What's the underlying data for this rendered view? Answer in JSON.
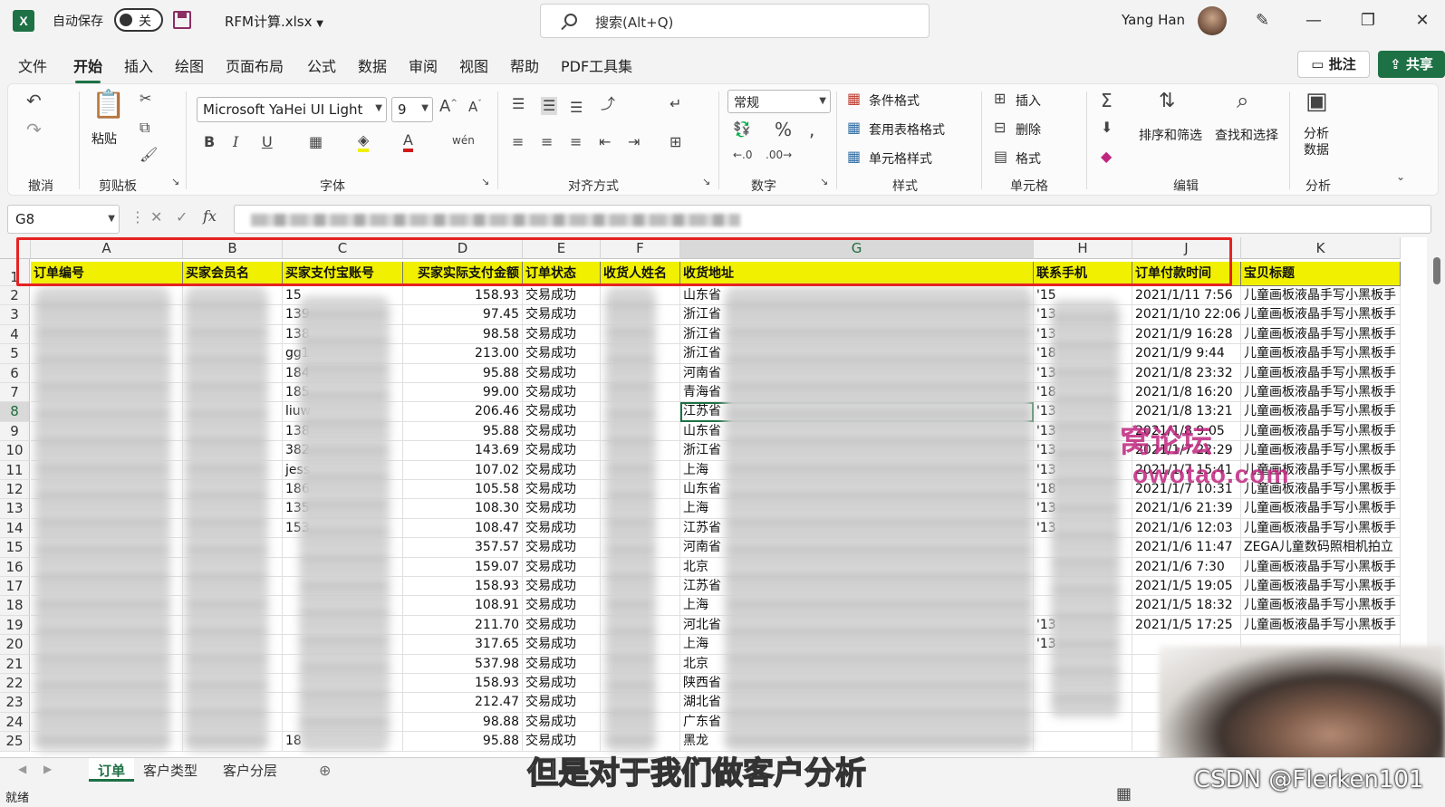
{
  "titlebar": {
    "autosave_label": "自动保存",
    "autosave_state": "关",
    "filename": "RFM计算.xlsx",
    "search_placeholder": "搜索(Alt+Q)",
    "user_name": "Yang Han"
  },
  "menu": {
    "items": [
      "文件",
      "开始",
      "插入",
      "绘图",
      "页面布局",
      "公式",
      "数据",
      "审阅",
      "视图",
      "帮助",
      "PDF工具集"
    ],
    "active": "开始",
    "comment_button": "批注",
    "share_button": "共享"
  },
  "ribbon": {
    "undo_group": "撤消",
    "clipboard": {
      "paste": "粘贴",
      "group": "剪贴板"
    },
    "font": {
      "name": "Microsoft YaHei UI Light",
      "size": "9",
      "group": "字体"
    },
    "alignment_group": "对齐方式",
    "number": {
      "format": "常规",
      "group": "数字"
    },
    "styles": {
      "conditional": "条件格式",
      "table": "套用表格格式",
      "cell": "单元格样式",
      "group": "样式"
    },
    "cells": {
      "insert": "插入",
      "delete": "删除",
      "format": "格式",
      "group": "单元格"
    },
    "editing": {
      "sort": "排序和筛选",
      "find": "查找和选择",
      "group": "编辑"
    },
    "analysis": {
      "analyze": "分析数据",
      "group": "分析"
    }
  },
  "formula_bar": {
    "cell_ref": "G8"
  },
  "sheet": {
    "columns": [
      "A",
      "B",
      "C",
      "D",
      "E",
      "F",
      "G",
      "H",
      "J",
      "K"
    ],
    "headers": [
      "订单编号",
      "买家会员名",
      "买家支付宝账号",
      "买家实际支付金额",
      "订单状态",
      "收货人姓名",
      "收货地址",
      "联系手机",
      "订单付款时间",
      "宝贝标题"
    ],
    "rows": [
      {
        "n": "2",
        "c": "15",
        "d": "158.93",
        "e": "交易成功",
        "g": "山东省",
        "h": "'15",
        "j": "2021/1/11 7:56",
        "k": "儿童画板液晶手写小黑板手"
      },
      {
        "n": "3",
        "c": "139",
        "d": "97.45",
        "e": "交易成功",
        "g": "浙江省",
        "h": "'13",
        "j": "2021/1/10 22:06",
        "k": "儿童画板液晶手写小黑板手"
      },
      {
        "n": "4",
        "c": "138",
        "d": "98.58",
        "e": "交易成功",
        "g": "浙江省",
        "h": "'13",
        "j": "2021/1/9 16:28",
        "k": "儿童画板液晶手写小黑板手"
      },
      {
        "n": "5",
        "c": "gg1",
        "d": "213.00",
        "e": "交易成功",
        "g": "浙江省",
        "h": "'18",
        "j": "2021/1/9 9:44",
        "k": "儿童画板液晶手写小黑板手"
      },
      {
        "n": "6",
        "c": "184",
        "d": "95.88",
        "e": "交易成功",
        "g": "河南省",
        "h": "'13",
        "j": "2021/1/8 23:32",
        "k": "儿童画板液晶手写小黑板手"
      },
      {
        "n": "7",
        "c": "185",
        "d": "99.00",
        "e": "交易成功",
        "g": "青海省",
        "h": "'18",
        "j": "2021/1/8 16:20",
        "k": "儿童画板液晶手写小黑板手"
      },
      {
        "n": "8",
        "c": "liuw",
        "d": "206.46",
        "e": "交易成功",
        "g": "江苏省",
        "h": "'13",
        "j": "2021/1/8 13:21",
        "k": "儿童画板液晶手写小黑板手"
      },
      {
        "n": "9",
        "c": "138",
        "d": "95.88",
        "e": "交易成功",
        "g": "山东省",
        "h": "'13",
        "j": "2021/1/8 9:05",
        "k": "儿童画板液晶手写小黑板手"
      },
      {
        "n": "10",
        "c": "382",
        "d": "143.69",
        "e": "交易成功",
        "g": "浙江省",
        "h": "'13",
        "j": "2021/1/7 22:29",
        "k": "儿童画板液晶手写小黑板手"
      },
      {
        "n": "11",
        "c": "jess",
        "d": "107.02",
        "e": "交易成功",
        "g": "上海",
        "h": "'13",
        "j": "2021/1/7 15:41",
        "k": "儿童画板液晶手写小黑板手"
      },
      {
        "n": "12",
        "c": "186",
        "d": "105.58",
        "e": "交易成功",
        "g": "山东省",
        "h": "'18",
        "j": "2021/1/7 10:31",
        "k": "儿童画板液晶手写小黑板手"
      },
      {
        "n": "13",
        "c": "135",
        "d": "108.30",
        "e": "交易成功",
        "g": "上海",
        "h": "'13",
        "j": "2021/1/6 21:39",
        "k": "儿童画板液晶手写小黑板手"
      },
      {
        "n": "14",
        "c": "153",
        "d": "108.47",
        "e": "交易成功",
        "g": "江苏省",
        "h": "'13",
        "j": "2021/1/6 12:03",
        "k": "儿童画板液晶手写小黑板手"
      },
      {
        "n": "15",
        "c": "",
        "d": "357.57",
        "e": "交易成功",
        "g": "河南省",
        "h": "",
        "j": "2021/1/6 11:47",
        "k": "ZEGA儿童数码照相机拍立"
      },
      {
        "n": "16",
        "c": "",
        "d": "159.07",
        "e": "交易成功",
        "g": "北京",
        "h": "",
        "j": "2021/1/6 7:30",
        "k": "儿童画板液晶手写小黑板手"
      },
      {
        "n": "17",
        "c": "",
        "d": "158.93",
        "e": "交易成功",
        "g": "江苏省",
        "h": "",
        "j": "2021/1/5 19:05",
        "k": "儿童画板液晶手写小黑板手"
      },
      {
        "n": "18",
        "c": "",
        "d": "108.91",
        "e": "交易成功",
        "g": "上海",
        "h": "",
        "j": "2021/1/5 18:32",
        "k": "儿童画板液晶手写小黑板手"
      },
      {
        "n": "19",
        "c": "",
        "d": "211.70",
        "e": "交易成功",
        "g": "河北省",
        "h": "'13",
        "j": "2021/1/5 17:25",
        "k": "儿童画板液晶手写小黑板手"
      },
      {
        "n": "20",
        "c": "",
        "d": "317.65",
        "e": "交易成功",
        "g": "上海",
        "h": "'13",
        "j": "",
        "k": ""
      },
      {
        "n": "21",
        "c": "",
        "d": "537.98",
        "e": "交易成功",
        "g": "北京",
        "h": "",
        "j": "",
        "k": ""
      },
      {
        "n": "22",
        "c": "",
        "d": "158.93",
        "e": "交易成功",
        "g": "陕西省",
        "h": "",
        "j": "",
        "k": ""
      },
      {
        "n": "23",
        "c": "",
        "d": "212.47",
        "e": "交易成功",
        "g": "湖北省",
        "h": "",
        "j": "",
        "k": ""
      },
      {
        "n": "24",
        "c": "",
        "d": "98.88",
        "e": "交易成功",
        "g": "广东省",
        "h": "",
        "j": "",
        "k": ""
      },
      {
        "n": "25",
        "c": "18",
        "d": "95.88",
        "e": "交易成功",
        "g": "黑龙",
        "h": "",
        "j": "",
        "k": ""
      }
    ]
  },
  "sheet_tabs": [
    "订单",
    "客户类型",
    "客户分层"
  ],
  "status": {
    "ready": "就绪"
  },
  "overlay": {
    "subtitle": "但是对于我们做客户分析",
    "watermark_line1": "窝论坛",
    "watermark_line2": "owotao.com",
    "credit": "CSDN @Flerken101"
  },
  "colors": {
    "excel_green": "#1e7145",
    "header_yellow": "#f0f000",
    "highlight_red": "#e62222",
    "watermark": "#c0257f"
  }
}
